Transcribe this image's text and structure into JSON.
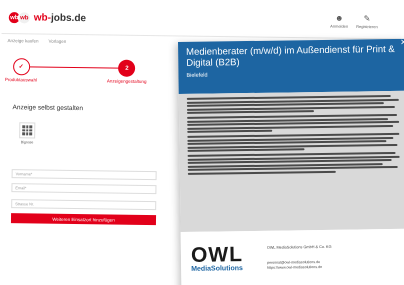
{
  "header": {
    "logo_mark_1": "wb",
    "logo_mark_2": "wb",
    "logo_text_red": "wb-",
    "logo_text_dark": "jobs.de",
    "actions": [
      {
        "icon": "user-icon",
        "label": "Anmelden"
      },
      {
        "icon": "register-icon",
        "label": "Registrieren"
      }
    ]
  },
  "subnav": {
    "back": "Anzeige kaufen",
    "products": "Vorlagen"
  },
  "steps": [
    {
      "number": "✓",
      "label": "Produktauswahl",
      "state": "done"
    },
    {
      "number": "2",
      "label": "Anzeigengestaltung",
      "state": "active"
    }
  ],
  "form": {
    "title": "Anzeige selbst gestalten",
    "upload_label": "Bignose",
    "fields": [
      {
        "placeholder": "Vorname*"
      },
      {
        "placeholder": "Email*"
      },
      {
        "placeholder": "Strasse Nr."
      }
    ],
    "cta": "Weiteren Einsatzort hinzufügen"
  },
  "ad": {
    "title": "Medienberater (m/w/d) im Außendienst für Print & Digital (B2B)",
    "location": "Bielefeld",
    "company_line": "OWL MediaSolutions GmbH & Co. KG",
    "brand": "OWL",
    "brand_sub": "MediaSolutions",
    "contact_email": "personal@owl-mediasolutions.de",
    "contact_web": "https://www.owl-mediasolutions.de"
  },
  "colors": {
    "brand_red": "#e2001a",
    "ad_blue": "#1d65a2"
  }
}
